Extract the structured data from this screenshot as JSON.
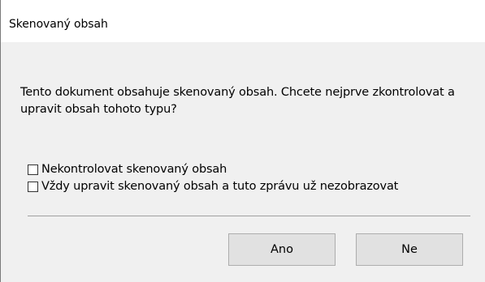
{
  "window": {
    "title": "Skenovaný obsah"
  },
  "dialog": {
    "message": "Tento dokument obsahuje skenovaný obsah. Chcete nejprve zkontrolovat a upravit obsah tohoto typu?",
    "options": [
      {
        "label": "Nekontrolovat skenovaný obsah",
        "checked": false
      },
      {
        "label": "Vždy upravit skenovaný obsah a tuto zprávu už nezobrazovat",
        "checked": false
      }
    ],
    "buttons": {
      "yes": "Ano",
      "no": "Ne"
    }
  }
}
